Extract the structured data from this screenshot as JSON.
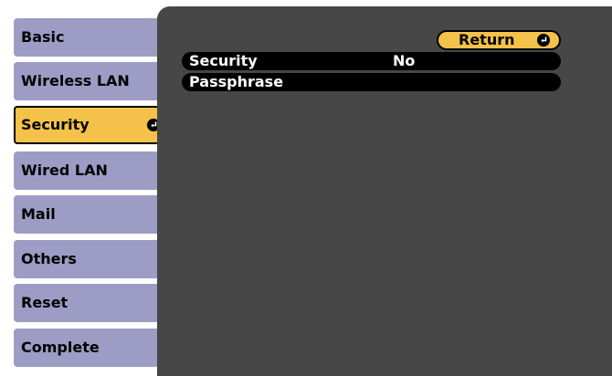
{
  "menu": {
    "items": [
      {
        "label": "Basic"
      },
      {
        "label": "Wireless LAN"
      },
      {
        "label": "Security"
      },
      {
        "label": "Wired LAN"
      },
      {
        "label": "Mail"
      },
      {
        "label": "Others"
      },
      {
        "label": "Reset"
      },
      {
        "label": "Complete"
      }
    ],
    "selected": "Security"
  },
  "panel": {
    "return_label": "Return",
    "rows": [
      {
        "label": "Security",
        "value": "No"
      },
      {
        "label": "Passphrase",
        "value": ""
      }
    ]
  },
  "colors": {
    "menu_item": "#9c9cc4",
    "selected": "#f4c24a",
    "panel_bg": "#474747",
    "row_bg": "#000000"
  },
  "icons": {
    "enter": "enter-icon"
  }
}
